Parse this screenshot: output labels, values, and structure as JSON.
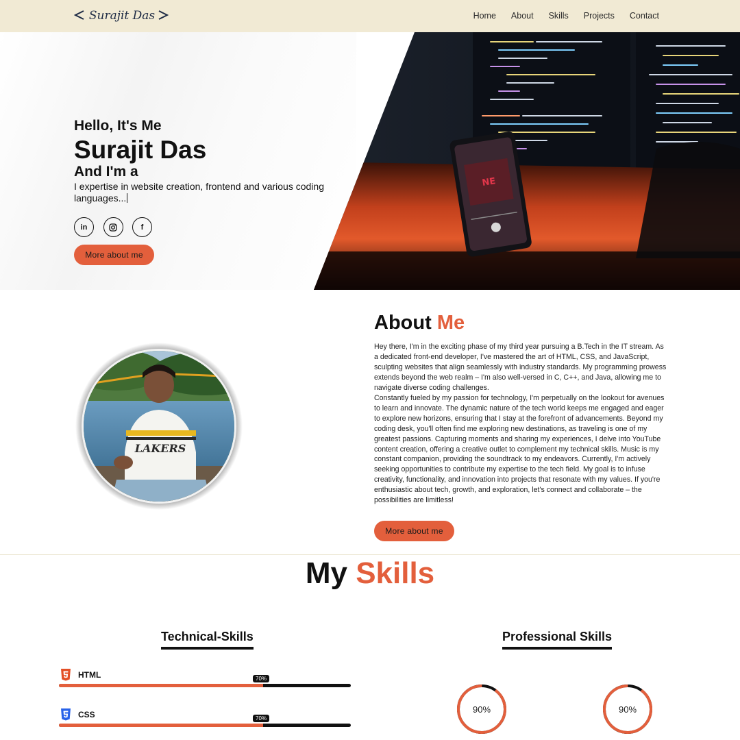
{
  "nav": {
    "logo_text": "Surajit Das",
    "links": [
      "Home",
      "About",
      "Skills",
      "Projects",
      "Contact"
    ]
  },
  "hero": {
    "hello": "Hello, It's Me",
    "name": "Surajit Das",
    "role_prefix": "And I'm a",
    "tagline": "I expertise in website creation, frontend and various coding languages...",
    "socials": [
      "linkedin-icon",
      "instagram-icon",
      "facebook-icon"
    ],
    "button": "More about me"
  },
  "about": {
    "title_a": "About ",
    "title_b": "Me",
    "paragraph_1": "Hey there, I'm in the exciting phase of my third year pursuing a B.Tech in the IT stream. As a dedicated front-end developer, I've mastered the art of HTML, CSS, and JavaScript, sculpting websites that align seamlessly with industry standards. My programming prowess extends beyond the web realm – I'm also well-versed in C, C++, and Java, allowing me to navigate diverse coding challenges.",
    "paragraph_2": "Constantly fueled by my passion for technology, I'm perpetually on the lookout for avenues to learn and innovate. The dynamic nature of the tech world keeps me engaged and eager to explore new horizons, ensuring that I stay at the forefront of advancements. Beyond my coding desk, you'll often find me exploring new destinations, as traveling is one of my greatest passions. Capturing moments and sharing my experiences, I delve into YouTube content creation, offering a creative outlet to complement my technical skills. Music is my constant companion, providing the soundtrack to my endeavors. Currently, I'm actively seeking opportunities to contribute my expertise to the tech field. My goal is to infuse creativity, functionality, and innovation into projects that resonate with my values. If you're enthusiastic about tech, growth, and exploration, let's connect and collaborate – the possibilities are limitless!",
    "button": "More about me"
  },
  "skills": {
    "title_a": "My ",
    "title_b": "Skills",
    "technical_title": "Technical-Skills",
    "professional_title": "Professional Skills",
    "technical": [
      {
        "name": "HTML",
        "percent_label": "70%",
        "level": 0.7,
        "icon": "html5-icon",
        "color": "#e34f26"
      },
      {
        "name": "CSS",
        "percent_label": "70%",
        "level": 0.7,
        "icon": "css3-icon",
        "color": "#2862e9"
      }
    ],
    "professional": [
      {
        "percent_label": "90%",
        "level": 0.9
      },
      {
        "percent_label": "90%",
        "level": 0.9
      }
    ]
  },
  "colors": {
    "accent": "#e35f3c",
    "nav_bg": "#f1ead4",
    "text": "#111111"
  }
}
